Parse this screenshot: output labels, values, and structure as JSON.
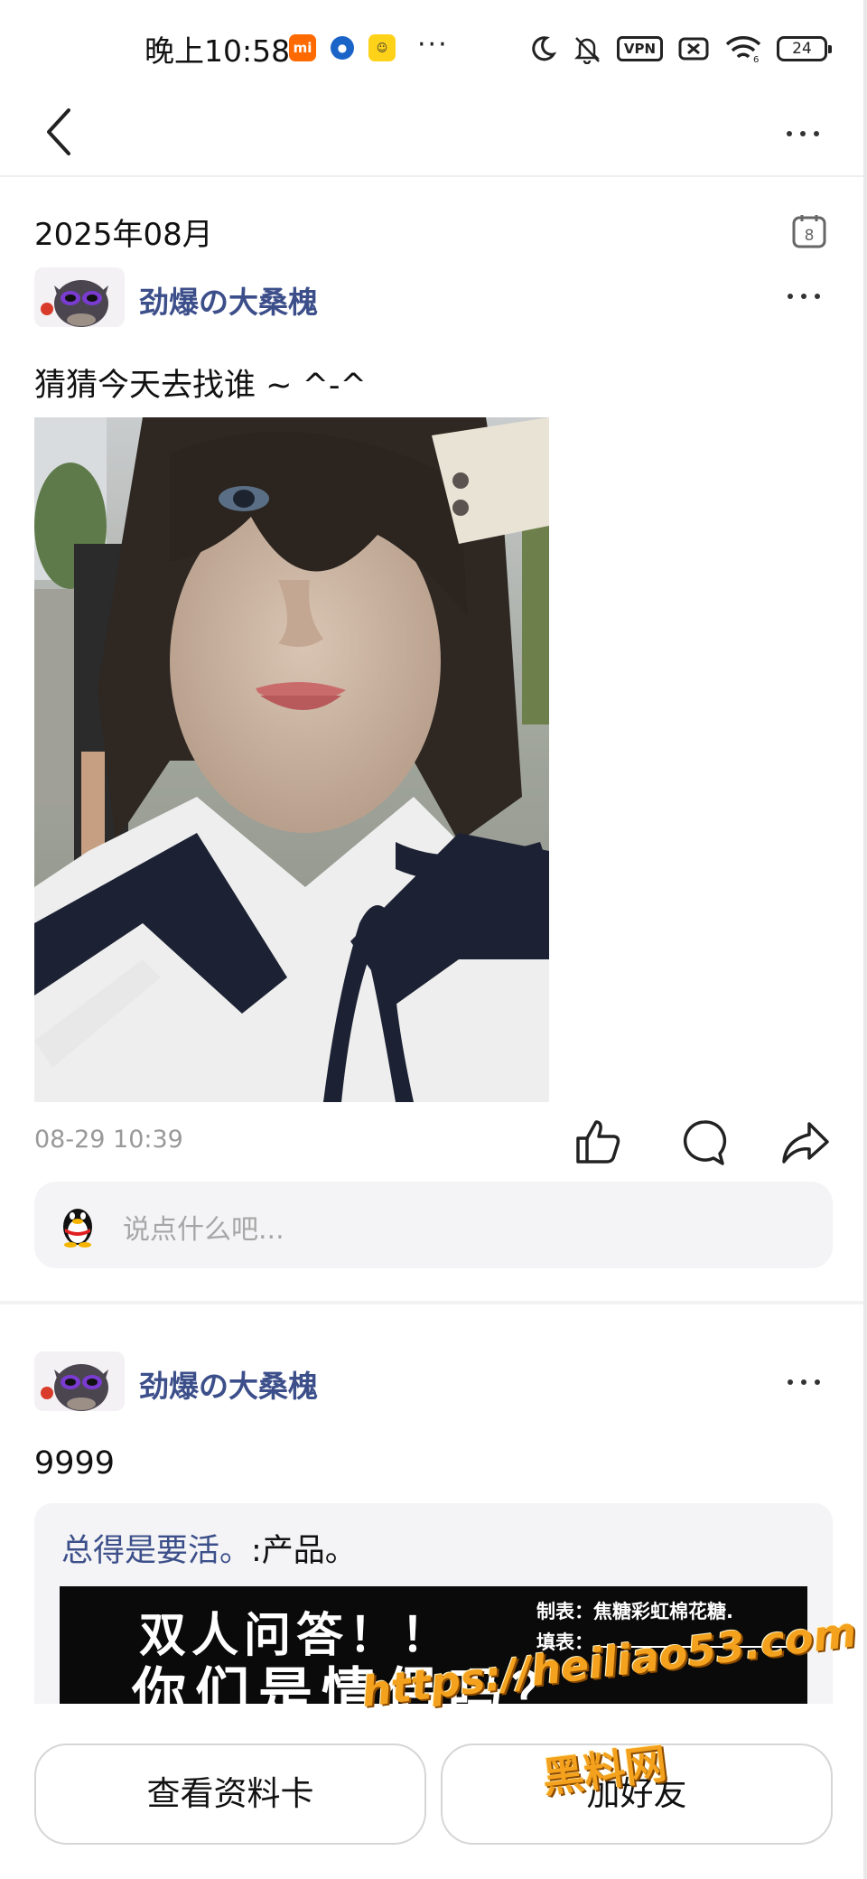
{
  "status_bar": {
    "time": "晚上10:58",
    "app_badges": [
      "mi-app-icon",
      "browser-app-icon",
      "game-app-icon"
    ],
    "more_notifications": "···",
    "vpn": "VPN",
    "battery": "24"
  },
  "header": {
    "back_icon": "chevron-left-icon",
    "more_icon": "more-horizontal-icon"
  },
  "month": {
    "label": "2025年08月",
    "calendar_day": "8"
  },
  "posts": [
    {
      "author": "劲爆の大桑槐",
      "text": "猜猜今天去找谁 ~ ^-^",
      "time": "08-29 10:39",
      "comment_placeholder": "说点什么吧..."
    },
    {
      "author": "劲爆の大桑槐",
      "text": "9999",
      "quote_source": "总得是要活。",
      "quote_author": ":产品。",
      "banner": {
        "line1": "双人问答！！",
        "line2": "你们是情侣吗？",
        "maker": "制表：焦糖彩虹棉花糖.",
        "filler": "填表："
      }
    }
  ],
  "bottom": {
    "profile_button": "查看资料卡",
    "add_friend_button": "加好友"
  },
  "watermark": {
    "url": "https://heiliao53.com",
    "name": "黑料网"
  },
  "colors": {
    "author": "#3c4f8a",
    "watermark": "#f4a21e",
    "placeholder": "#a6a6a6"
  }
}
